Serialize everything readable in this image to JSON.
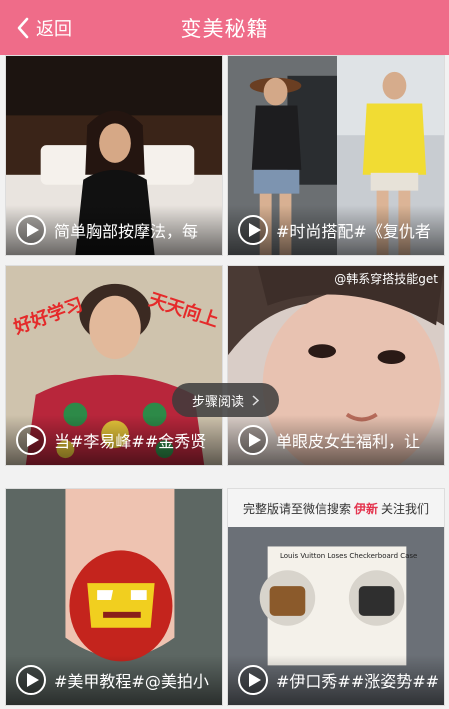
{
  "header": {
    "back_label": "返回",
    "title": "变美秘籍"
  },
  "tiles": [
    {
      "caption": "简单胸部按摩法，每"
    },
    {
      "caption": "#时尚搭配#《复仇者"
    },
    {
      "caption": "当#李易峰##金秀贤",
      "stamp_left": "好好学习",
      "stamp_right": "天天向上"
    },
    {
      "caption": "单眼皮女生福利，让",
      "watermark": "@韩系穿搭技能get"
    },
    {
      "caption": "#美甲教程#@美拍小"
    },
    {
      "caption": "#伊口秀##涨姿势##",
      "promo_prefix": "完整版请至微信搜索",
      "promo_brand": "伊新",
      "promo_suffix": "关注我们",
      "inner_title": "Louis Vuitton Loses Checkerboard Case"
    }
  ],
  "tooltip": {
    "label": "步骤阅读"
  },
  "colors": {
    "header_bg": "#ef6c89",
    "brand_red": "#e4344e"
  }
}
